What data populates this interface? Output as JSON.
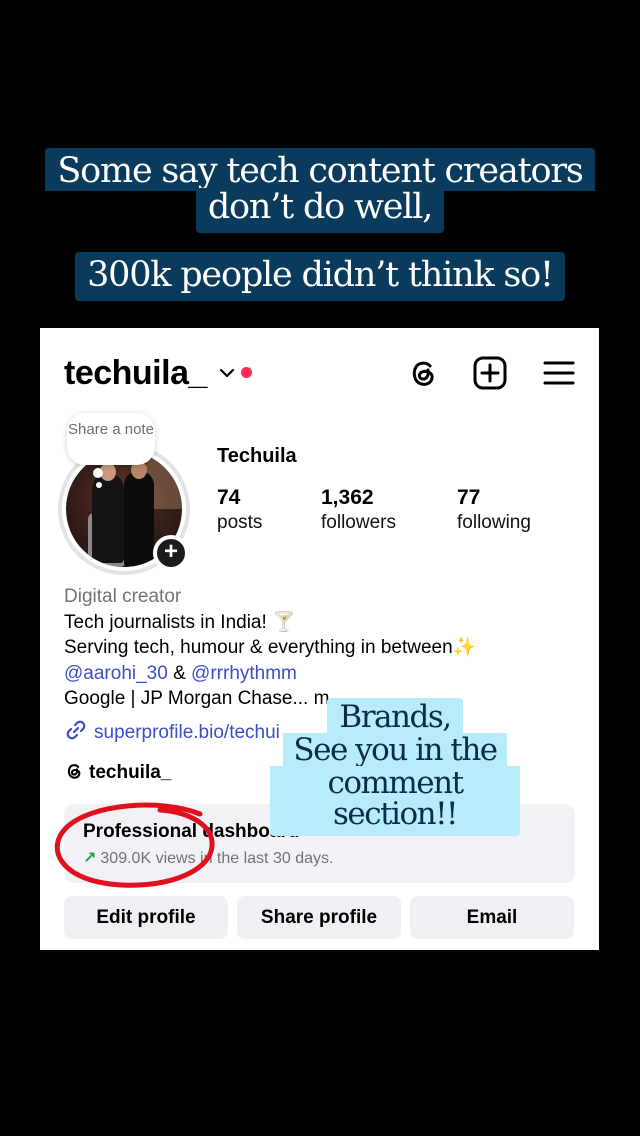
{
  "captions": {
    "line1": "Some say tech content creators",
    "line2": "don’t do well,",
    "line3": "300k people didn’t think so!"
  },
  "overlay": {
    "line1": "Brands,",
    "line2": "See you in the",
    "line3": "comment section!!"
  },
  "profile": {
    "username": "techuila_",
    "note_text": "Share a note",
    "display_name": "Techuila",
    "stats": [
      {
        "value": "74",
        "label": "posts"
      },
      {
        "value": "1,362",
        "label": "followers"
      },
      {
        "value": "77",
        "label": "following"
      }
    ],
    "bio": {
      "category": "Digital creator",
      "line1": "Tech journalists in India! 🍸",
      "line2": "Serving tech, humour & everything in between✨",
      "mention1": "@aarohi_30",
      "mention_sep": " & ",
      "mention2": "@rrrhythmm",
      "line4": "Google | JP Morgan Chase... m"
    },
    "link": "superprofile.bio/techui",
    "threads_handle": "techuila_"
  },
  "dashboard": {
    "title": "Professional dashboard",
    "arrow": "↗",
    "subtitle": "309.0K views in the last 30 days."
  },
  "buttons": {
    "edit": "Edit profile",
    "share": "Share profile",
    "email": "Email"
  },
  "colors": {
    "caption_bg": "#0a3a5c",
    "overlay_bg": "#b8ecfa",
    "notification_dot": "#ff2d55",
    "link": "#3c4ec6",
    "annotation_circle": "#e0101c"
  },
  "icons": [
    "chevron-down-icon",
    "threads-icon",
    "new-post-icon",
    "menu-icon",
    "link-icon",
    "trend-up-icon"
  ]
}
